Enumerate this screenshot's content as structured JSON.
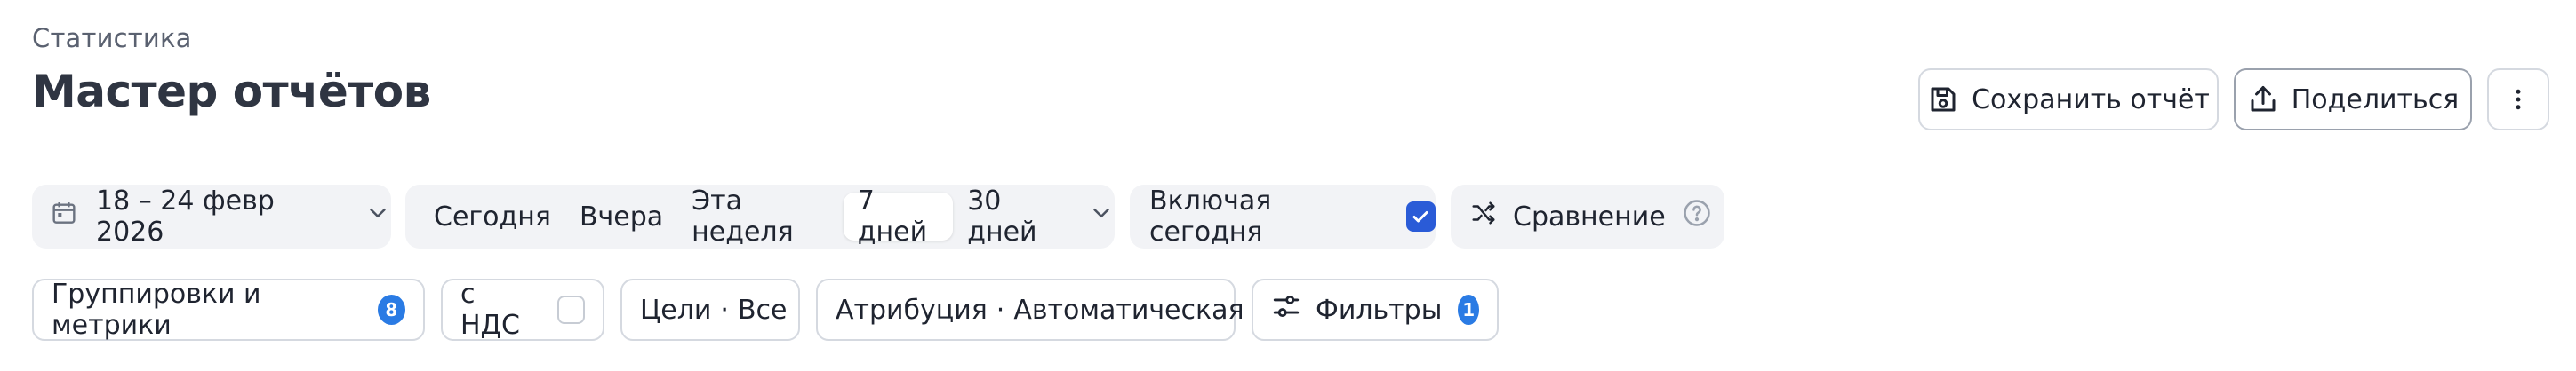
{
  "header": {
    "breadcrumb": "Статистика",
    "title": "Мастер отчётов",
    "save_label": "Сохранить отчёт",
    "share_label": "Поделиться"
  },
  "period": {
    "date_range": "18 – 24 февр 2026",
    "presets": [
      "Сегодня",
      "Вчера",
      "Эта неделя",
      "7 дней",
      "30 дней"
    ],
    "active_preset": "7 дней",
    "include_today_label": "Включая сегодня",
    "include_today_checked": true,
    "compare_label": "Сравнение"
  },
  "chips": {
    "groupings_label": "Группировки и метрики",
    "groupings_count": "8",
    "vat_label": "с НДС",
    "vat_checked": false,
    "goals_label": "Цели",
    "goals_value": "Все",
    "attribution_label": "Атрибуция",
    "attribution_value": "Автоматическая",
    "filters_label": "Фильтры",
    "filters_count": "1"
  },
  "colors": {
    "accent": "#2a5bd7",
    "badge": "#2a7be4",
    "segment_bg": "#f2f3f6",
    "border": "#d5d9e0"
  }
}
